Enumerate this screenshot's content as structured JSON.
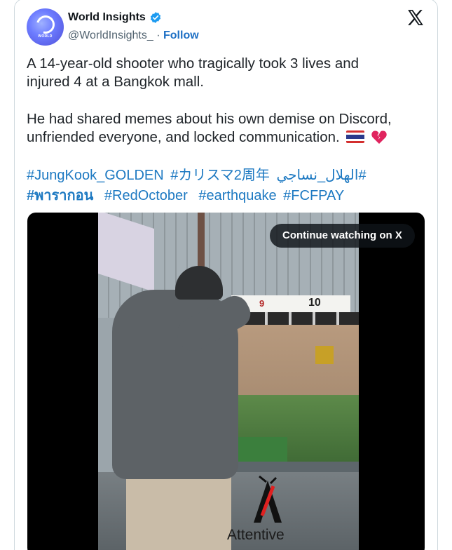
{
  "tweet": {
    "display_name": "World Insights",
    "handle": "@WorldInsights_",
    "separator": " · ",
    "follow_label": "Follow",
    "avatar_text": "WORLD",
    "text_line1": "A 14-year-old shooter who tragically took 3 lives and",
    "text_line2": "injured 4 at a Bangkok mall.",
    "text_line3": "He had shared memes about his own demise on Discord,",
    "text_line4": "unfriended everyone, and locked communication.",
    "hashtags_row1": [
      "#JungKook_GOLDEN",
      "#カリスマ2周年",
      "#الهلال_نساجي"
    ],
    "hashtags_row2": [
      "#พารากอน",
      "#RedOctober",
      "#earthquake",
      "#FCFPAY"
    ],
    "emoji": [
      "flag-thailand-icon",
      "broken-heart-icon"
    ]
  },
  "video": {
    "continue_label": "Continue watching on X",
    "watermark_text": "Attentive",
    "board_numbers": [
      "9",
      "10"
    ]
  },
  "colors": {
    "link": "#1d79c2",
    "follow": "#1d6fc4",
    "verified": "#1d9bf0",
    "text": "#1f2429",
    "muted": "#536471"
  }
}
